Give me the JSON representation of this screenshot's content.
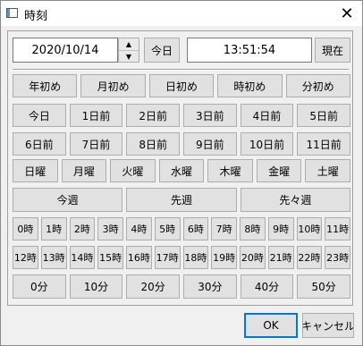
{
  "window": {
    "title": "時刻",
    "close_glyph": "✕"
  },
  "top": {
    "date_value": "2020/10/14",
    "today_label": "今日",
    "time_value": "13:51:54",
    "now_label": "現在",
    "spin_up": "▲",
    "spin_down": "▼"
  },
  "rows": {
    "starts": [
      "年初め",
      "月初め",
      "日初め",
      "時初め",
      "分初め"
    ],
    "days_ago_1": [
      "今日",
      "1日前",
      "2日前",
      "3日前",
      "4日前",
      "5日前"
    ],
    "days_ago_2": [
      "6日前",
      "7日前",
      "8日前",
      "9日前",
      "10日前",
      "11日前"
    ],
    "weekdays": [
      "日曜",
      "月曜",
      "火曜",
      "水曜",
      "木曜",
      "金曜",
      "土曜"
    ],
    "weeks": [
      "今週",
      "先週",
      "先々週"
    ],
    "hours_1": [
      "0時",
      "1時",
      "2時",
      "3時",
      "4時",
      "5時",
      "6時",
      "7時",
      "8時",
      "9時",
      "10時",
      "11時"
    ],
    "hours_2": [
      "12時",
      "13時",
      "14時",
      "15時",
      "16時",
      "17時",
      "18時",
      "19時",
      "20時",
      "21時",
      "22時",
      "23時"
    ],
    "minutes": [
      "0分",
      "10分",
      "20分",
      "30分",
      "40分",
      "50分"
    ]
  },
  "footer": {
    "ok_label": "OK",
    "cancel_label": "キャンセル"
  }
}
